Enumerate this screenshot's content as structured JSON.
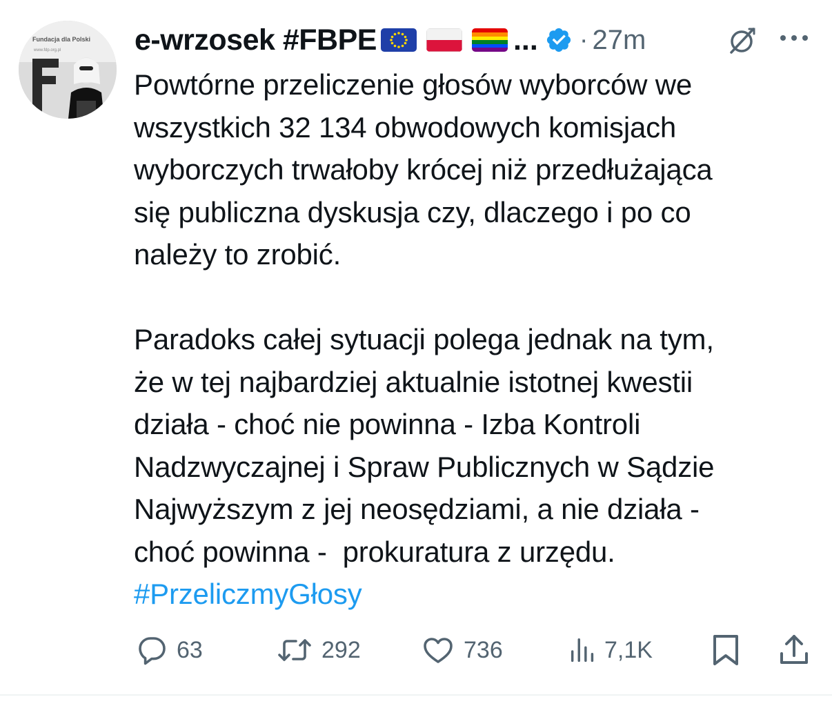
{
  "tweet": {
    "display_name": "e-wrzosek #FBPE",
    "name_flags": [
      "eu-flag-icon",
      "poland-flag-icon",
      "rainbow-flag-icon"
    ],
    "name_ellipsis": "...",
    "separator": "·",
    "time": "27m",
    "paragraph1": "Powtórne przeliczenie głosów wyborców we\nwszystkich 32 134 obwodowych komisjach\nwyborczych trwałoby krócej niż przedłużająca\nsię publiczna dyskusja czy, dlaczego i po co\nnależy to zrobić.",
    "paragraph2": "Paradoks całej sytuacji polega jednak na tym,\nże w tej najbardziej aktualnie istotnej kwestii\ndziała - choć nie powinna - Izba Kontroli\nNadzwyczajnej i Spraw Publicznych w Sądzie\nNajwyższym z jej neosędziami, a nie działa -\nchoć powinna -  prokuratura z urzędu.",
    "hashtag": "#PrzeliczmyGłosy",
    "avatar_text": [
      "Fundacja dla Polski",
      "www.fdp.org.pl"
    ]
  },
  "actions": {
    "replies": "63",
    "reposts": "292",
    "likes": "736",
    "views": "7,1K"
  },
  "colors": {
    "text": "#0f1419",
    "secondary": "#536471",
    "link": "#1d9bf0",
    "verified": "#1d9bf0"
  }
}
